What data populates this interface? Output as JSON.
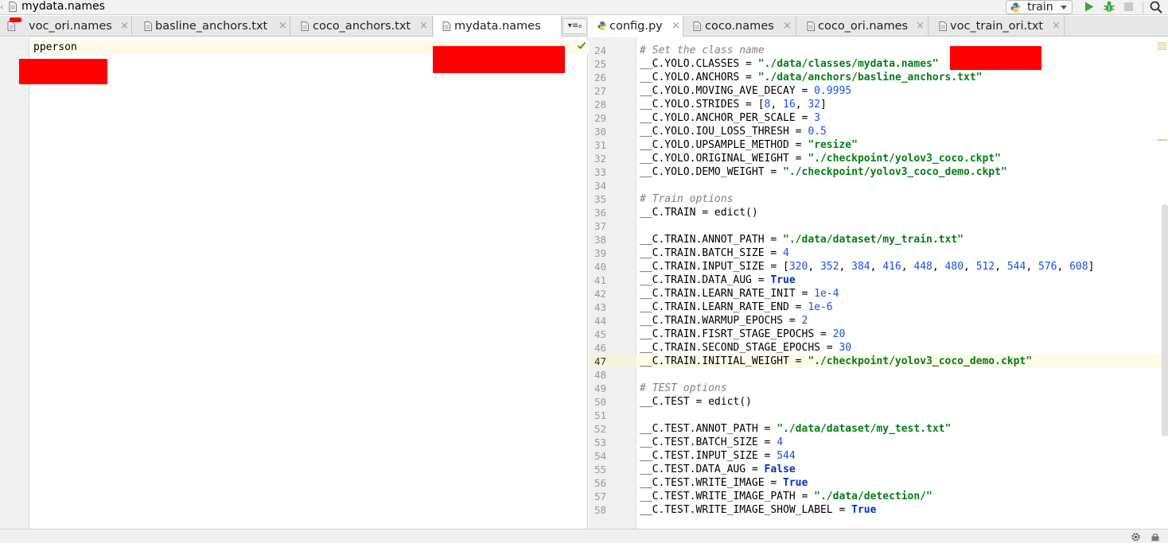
{
  "navbar": {
    "title": "mydata.names",
    "run_config_label": "train"
  },
  "left_tabs": [
    {
      "label": "voc_ori.names"
    },
    {
      "label": "basline_anchors.txt"
    },
    {
      "label": "coco_anchors.txt"
    },
    {
      "label": "mydata.names"
    }
  ],
  "right_tabs": [
    {
      "label": "config.py"
    },
    {
      "label": "coco.names"
    },
    {
      "label": "coco_ori.names"
    },
    {
      "label": "voc_train_ori.txt"
    }
  ],
  "tab_close_glyph": "×",
  "tab_overflow_glyph": "▾≡₆",
  "left_editor": {
    "text": "pperson"
  },
  "right_editor": {
    "lines": [
      {
        "n": "24",
        "parts": [
          [
            "cm",
            "# Set the class name"
          ]
        ]
      },
      {
        "n": "25",
        "parts": [
          [
            "",
            "__C.YOLO.CLASSES = "
          ],
          [
            "st",
            "\"./data/classes/mydata.names\""
          ]
        ]
      },
      {
        "n": "26",
        "parts": [
          [
            "",
            "__C.YOLO.ANCHORS = "
          ],
          [
            "st",
            "\"./data/anchors/basline_anchors.txt\""
          ]
        ]
      },
      {
        "n": "27",
        "parts": [
          [
            "",
            "__C.YOLO.MOVING_AVE_DECAY = "
          ],
          [
            "nm",
            "0.9995"
          ]
        ]
      },
      {
        "n": "28",
        "parts": [
          [
            "",
            "__C.YOLO.STRIDES = ["
          ],
          [
            "nm",
            "8"
          ],
          [
            "",
            ", "
          ],
          [
            "nm",
            "16"
          ],
          [
            "",
            ", "
          ],
          [
            "nm",
            "32"
          ],
          [
            "",
            "]"
          ]
        ]
      },
      {
        "n": "29",
        "parts": [
          [
            "",
            "__C.YOLO.ANCHOR_PER_SCALE = "
          ],
          [
            "nm",
            "3"
          ]
        ]
      },
      {
        "n": "30",
        "parts": [
          [
            "",
            "__C.YOLO.IOU_LOSS_THRESH = "
          ],
          [
            "nm",
            "0.5"
          ]
        ]
      },
      {
        "n": "31",
        "parts": [
          [
            "",
            "__C.YOLO.UPSAMPLE_METHOD = "
          ],
          [
            "st",
            "\"resize\""
          ]
        ]
      },
      {
        "n": "32",
        "parts": [
          [
            "",
            "__C.YOLO.ORIGINAL_WEIGHT = "
          ],
          [
            "st",
            "\"./checkpoint/yolov3_coco.ckpt\""
          ]
        ]
      },
      {
        "n": "33",
        "parts": [
          [
            "",
            "__C.YOLO.DEMO_WEIGHT = "
          ],
          [
            "st",
            "\"./checkpoint/yolov3_coco_demo.ckpt\""
          ]
        ]
      },
      {
        "n": "34",
        "parts": []
      },
      {
        "n": "35",
        "parts": [
          [
            "cm",
            "# Train options"
          ]
        ]
      },
      {
        "n": "36",
        "parts": [
          [
            "",
            "__C.TRAIN = edict()"
          ]
        ]
      },
      {
        "n": "37",
        "parts": []
      },
      {
        "n": "38",
        "parts": [
          [
            "",
            "__C.TRAIN.ANNOT_PATH = "
          ],
          [
            "st",
            "\"./data/dataset/my_train.txt\""
          ]
        ]
      },
      {
        "n": "39",
        "parts": [
          [
            "",
            "__C.TRAIN.BATCH_SIZE = "
          ],
          [
            "nm",
            "4"
          ]
        ]
      },
      {
        "n": "40",
        "parts": [
          [
            "",
            "__C.TRAIN.INPUT_SIZE = ["
          ],
          [
            "nm",
            "320"
          ],
          [
            "",
            ", "
          ],
          [
            "nm",
            "352"
          ],
          [
            "",
            ", "
          ],
          [
            "nm",
            "384"
          ],
          [
            "",
            ", "
          ],
          [
            "nm",
            "416"
          ],
          [
            "",
            ", "
          ],
          [
            "nm",
            "448"
          ],
          [
            "",
            ", "
          ],
          [
            "nm",
            "480"
          ],
          [
            "",
            ", "
          ],
          [
            "nm",
            "512"
          ],
          [
            "",
            ", "
          ],
          [
            "nm",
            "544"
          ],
          [
            "",
            ", "
          ],
          [
            "nm",
            "576"
          ],
          [
            "",
            ", "
          ],
          [
            "nm",
            "608"
          ],
          [
            "",
            "]"
          ]
        ]
      },
      {
        "n": "41",
        "parts": [
          [
            "",
            "__C.TRAIN.DATA_AUG = "
          ],
          [
            "kw",
            "True"
          ]
        ]
      },
      {
        "n": "42",
        "parts": [
          [
            "",
            "__C.TRAIN.LEARN_RATE_INIT = "
          ],
          [
            "nm",
            "1e-4"
          ]
        ]
      },
      {
        "n": "43",
        "parts": [
          [
            "",
            "__C.TRAIN.LEARN_RATE_END = "
          ],
          [
            "nm",
            "1e-6"
          ]
        ]
      },
      {
        "n": "44",
        "parts": [
          [
            "",
            "__C.TRAIN.WARMUP_EPOCHS = "
          ],
          [
            "nm",
            "2"
          ]
        ]
      },
      {
        "n": "45",
        "parts": [
          [
            "",
            "__C.TRAIN.FISRT_STAGE_EPOCHS = "
          ],
          [
            "nm",
            "20"
          ]
        ]
      },
      {
        "n": "46",
        "parts": [
          [
            "",
            "__C.TRAIN.SECOND_STAGE_EPOCHS = "
          ],
          [
            "nm",
            "30"
          ]
        ]
      },
      {
        "n": "47",
        "parts": [
          [
            "",
            "__C.TRAIN.INITIAL_WEIGHT = "
          ],
          [
            "st",
            "\"./checkpoint/yolov3_coco_demo.ckpt\""
          ]
        ]
      },
      {
        "n": "48",
        "parts": []
      },
      {
        "n": "49",
        "parts": [
          [
            "cm",
            "# TEST options"
          ]
        ]
      },
      {
        "n": "50",
        "parts": [
          [
            "",
            "__C.TEST = edict()"
          ]
        ]
      },
      {
        "n": "51",
        "parts": []
      },
      {
        "n": "52",
        "parts": [
          [
            "",
            "__C.TEST.ANNOT_PATH = "
          ],
          [
            "st",
            "\"./data/dataset/my_test.txt\""
          ]
        ]
      },
      {
        "n": "53",
        "parts": [
          [
            "",
            "__C.TEST.BATCH_SIZE = "
          ],
          [
            "nm",
            "4"
          ]
        ]
      },
      {
        "n": "54",
        "parts": [
          [
            "",
            "__C.TEST.INPUT_SIZE = "
          ],
          [
            "nm",
            "544"
          ]
        ]
      },
      {
        "n": "55",
        "parts": [
          [
            "",
            "__C.TEST.DATA_AUG = "
          ],
          [
            "kw",
            "False"
          ]
        ]
      },
      {
        "n": "56",
        "parts": [
          [
            "",
            "__C.TEST.WRITE_IMAGE = "
          ],
          [
            "kw",
            "True"
          ]
        ]
      },
      {
        "n": "57",
        "parts": [
          [
            "",
            "__C.TEST.WRITE_IMAGE_PATH = "
          ],
          [
            "st",
            "\"./data/detection/\""
          ]
        ]
      },
      {
        "n": "58",
        "parts": [
          [
            "",
            "__C.TEST.WRITE_IMAGE_SHOW_LABEL = "
          ],
          [
            "kw",
            "True"
          ]
        ]
      }
    ],
    "current_line": "47"
  },
  "colors": {
    "string": "#067d17",
    "number": "#1750eb",
    "keyword": "#0033b3",
    "comment": "#808080",
    "redaction": "#ff0000",
    "current_line": "#fdfbe8"
  },
  "icons": {
    "file": "file-icon",
    "python_file": "python-file-icon",
    "run": "run-icon",
    "debug": "debug-icon",
    "stop": "stop-icon",
    "search": "search-icon",
    "check": "check-icon",
    "settings": "gear-icon",
    "lock": "lock-icon"
  }
}
